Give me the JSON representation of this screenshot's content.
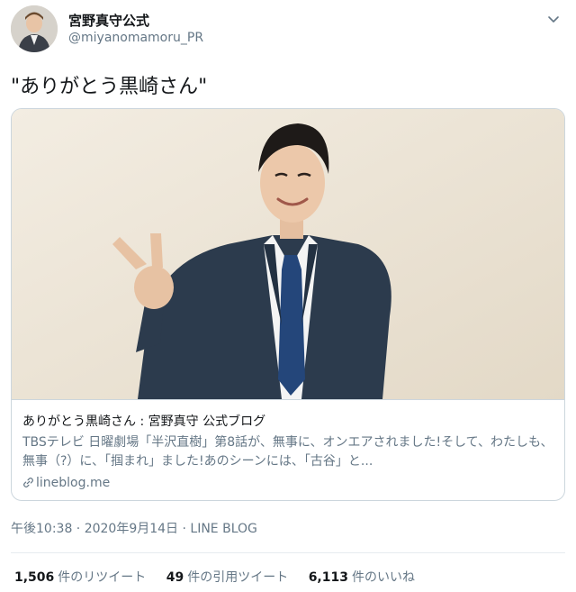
{
  "author": {
    "display_name": "宮野真守公式",
    "handle": "@miyanomamoru_PR"
  },
  "tweet": {
    "text": "\"ありがとう黒崎さん\""
  },
  "card": {
    "title": "ありがとう黒崎さん : 宮野真守 公式ブログ",
    "description": "TBSテレビ 日曜劇場「半沢直樹」第8話が、無事に、オンエアされました!そして、わたしも、無事（?）に、「掴まれ」ました!あのシーンには、「古谷」と...",
    "domain": "lineblog.me",
    "link_icon": "link-icon"
  },
  "meta": {
    "timestamp": "午後10:38 · 2020年9月14日 · LINE BLOG"
  },
  "stats": {
    "retweets_count": "1,506",
    "retweets_label": "件のリツイート",
    "quotes_count": "49",
    "quotes_label": "件の引用ツイート",
    "likes_count": "6,113",
    "likes_label": "件のいいね"
  },
  "colors": {
    "text_primary": "#14171a",
    "text_secondary": "#657786",
    "border": "#ccd6dd"
  }
}
